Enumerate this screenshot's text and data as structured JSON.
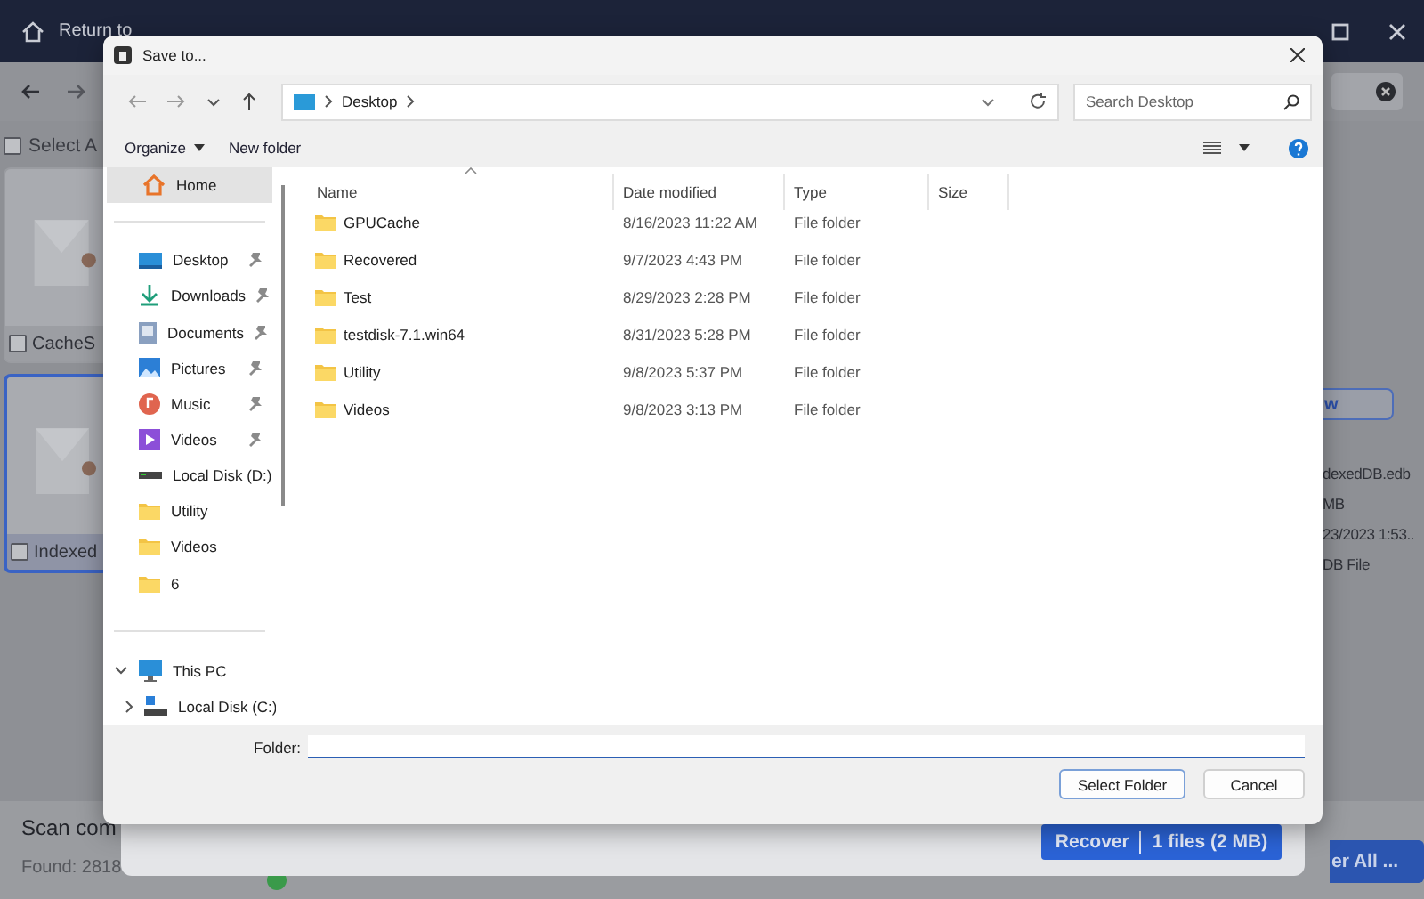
{
  "app": {
    "back_link": "Return to",
    "select_all": {
      "label": "Select A",
      "checked": false
    },
    "cards": [
      {
        "label": "CacheS",
        "checked": false,
        "selected": false
      },
      {
        "label": "Indexed",
        "checked": false,
        "selected": true
      }
    ],
    "preview_button": "w",
    "details": [
      "dexedDB.edb",
      "MB",
      "23/2023 1:53..",
      "DB File"
    ],
    "status_title": "Scan com",
    "status_text": "Found: 2818",
    "recover_all_button": "er All ..."
  },
  "recover_dialog": {
    "recover_button": {
      "label": "Recover",
      "summary": "1 files (2 MB)"
    }
  },
  "save_dialog": {
    "title": "Save to...",
    "address": [
      "Desktop"
    ],
    "search": {
      "placeholder": "Search Desktop"
    },
    "toolbar": {
      "organize": "Organize",
      "new_folder": "New folder"
    },
    "quick_access": [
      {
        "label": "Home",
        "kind": "home",
        "pinned": false,
        "selected": true
      },
      {
        "label": "Desktop",
        "kind": "desktop",
        "pinned": true,
        "selected": false
      },
      {
        "label": "Downloads",
        "kind": "downloads",
        "pinned": true,
        "selected": false
      },
      {
        "label": "Documents",
        "kind": "documents",
        "pinned": true,
        "selected": false
      },
      {
        "label": "Pictures",
        "kind": "pictures",
        "pinned": true,
        "selected": false
      },
      {
        "label": "Music",
        "kind": "music",
        "pinned": true,
        "selected": false
      },
      {
        "label": "Videos",
        "kind": "videos",
        "pinned": true,
        "selected": false
      },
      {
        "label": "Local Disk (D:)",
        "kind": "drive",
        "pinned": false,
        "selected": false
      },
      {
        "label": "Utility",
        "kind": "folder",
        "pinned": false,
        "selected": false
      },
      {
        "label": "Videos",
        "kind": "folder",
        "pinned": false,
        "selected": false
      },
      {
        "label": "6",
        "kind": "folder",
        "pinned": false,
        "selected": false
      }
    ],
    "tree": [
      {
        "label": "This PC",
        "kind": "computer",
        "expanded": true,
        "children": [
          {
            "label": "Local Disk (C:)",
            "kind": "system-drive",
            "expanded": false
          }
        ]
      }
    ],
    "columns": [
      "Name",
      "Date modified",
      "Type",
      "Size"
    ],
    "files": [
      {
        "name": "GPUCache",
        "date": "8/16/2023 11:22 AM",
        "type": "File folder"
      },
      {
        "name": "Recovered",
        "date": "9/7/2023 4:43 PM",
        "type": "File folder"
      },
      {
        "name": "Test",
        "date": "8/29/2023 2:28 PM",
        "type": "File folder"
      },
      {
        "name": "testdisk-7.1.win64",
        "date": "8/31/2023 5:28 PM",
        "type": "File folder"
      },
      {
        "name": "Utility",
        "date": "9/8/2023 5:37 PM",
        "type": "File folder"
      },
      {
        "name": "Videos",
        "date": "9/8/2023 3:13 PM",
        "type": "File folder"
      }
    ],
    "folder": {
      "label": "Folder:"
    },
    "buttons": [
      {
        "label": "Select Folder",
        "kind": "primary"
      },
      {
        "label": "Cancel",
        "kind": "secondary"
      }
    ]
  }
}
